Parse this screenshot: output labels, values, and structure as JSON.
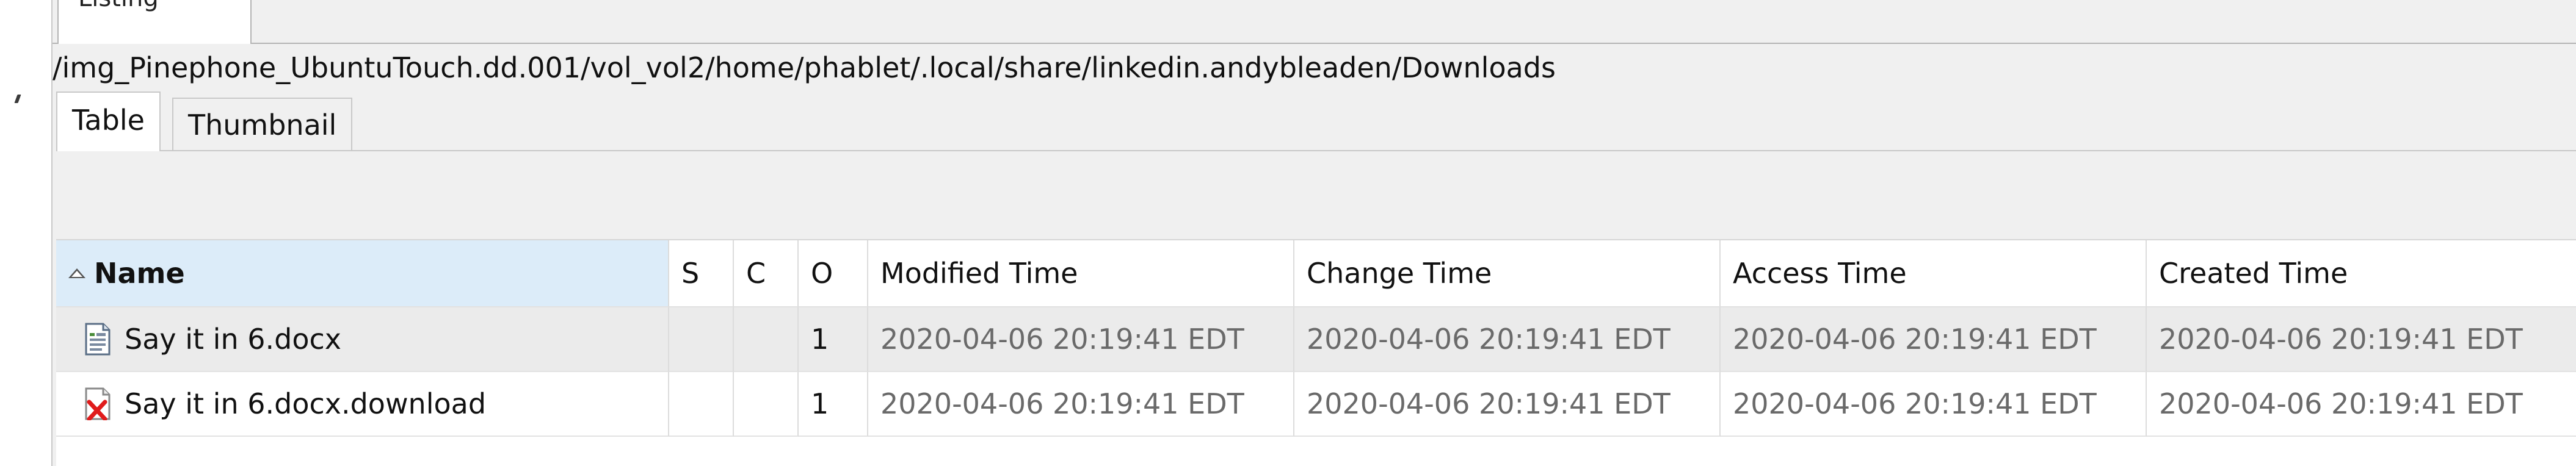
{
  "outer_tab": {
    "label": "Listing"
  },
  "path": "/img_Pinephone_UbuntuTouch.dd.001/vol_vol2/home/phablet/.local/share/linkedin.andybleaden/Downloads",
  "subtabs": [
    {
      "label": "Table",
      "active": true
    },
    {
      "label": "Thumbnail",
      "active": false
    }
  ],
  "table": {
    "sorted_column": "Name",
    "sort_direction": "ascending",
    "columns": [
      "Name",
      "S",
      "C",
      "O",
      "Modified Time",
      "Change Time",
      "Access Time",
      "Created Time"
    ],
    "rows": [
      {
        "icon": "document-icon",
        "name": "Say it in 6.docx",
        "s": "",
        "c": "",
        "o": "1",
        "modified": "2020-04-06 20:19:41 EDT",
        "change": "2020-04-06 20:19:41 EDT",
        "access": "2020-04-06 20:19:41 EDT",
        "created": "2020-04-06 20:19:41 EDT"
      },
      {
        "icon": "deleted-file-icon",
        "name": "Say it in 6.docx.download",
        "s": "",
        "c": "",
        "o": "1",
        "modified": "2020-04-06 20:19:41 EDT",
        "change": "2020-04-06 20:19:41 EDT",
        "access": "2020-04-06 20:19:41 EDT",
        "created": "2020-04-06 20:19:41 EDT"
      }
    ]
  },
  "colors": {
    "panel_bg": "#f0f0f0",
    "sorted_header_bg": "#dcecf9",
    "selected_row_bg": "#ebebeb",
    "time_text": "#6a6a6a",
    "deleted_mark": "#e01b1b"
  }
}
